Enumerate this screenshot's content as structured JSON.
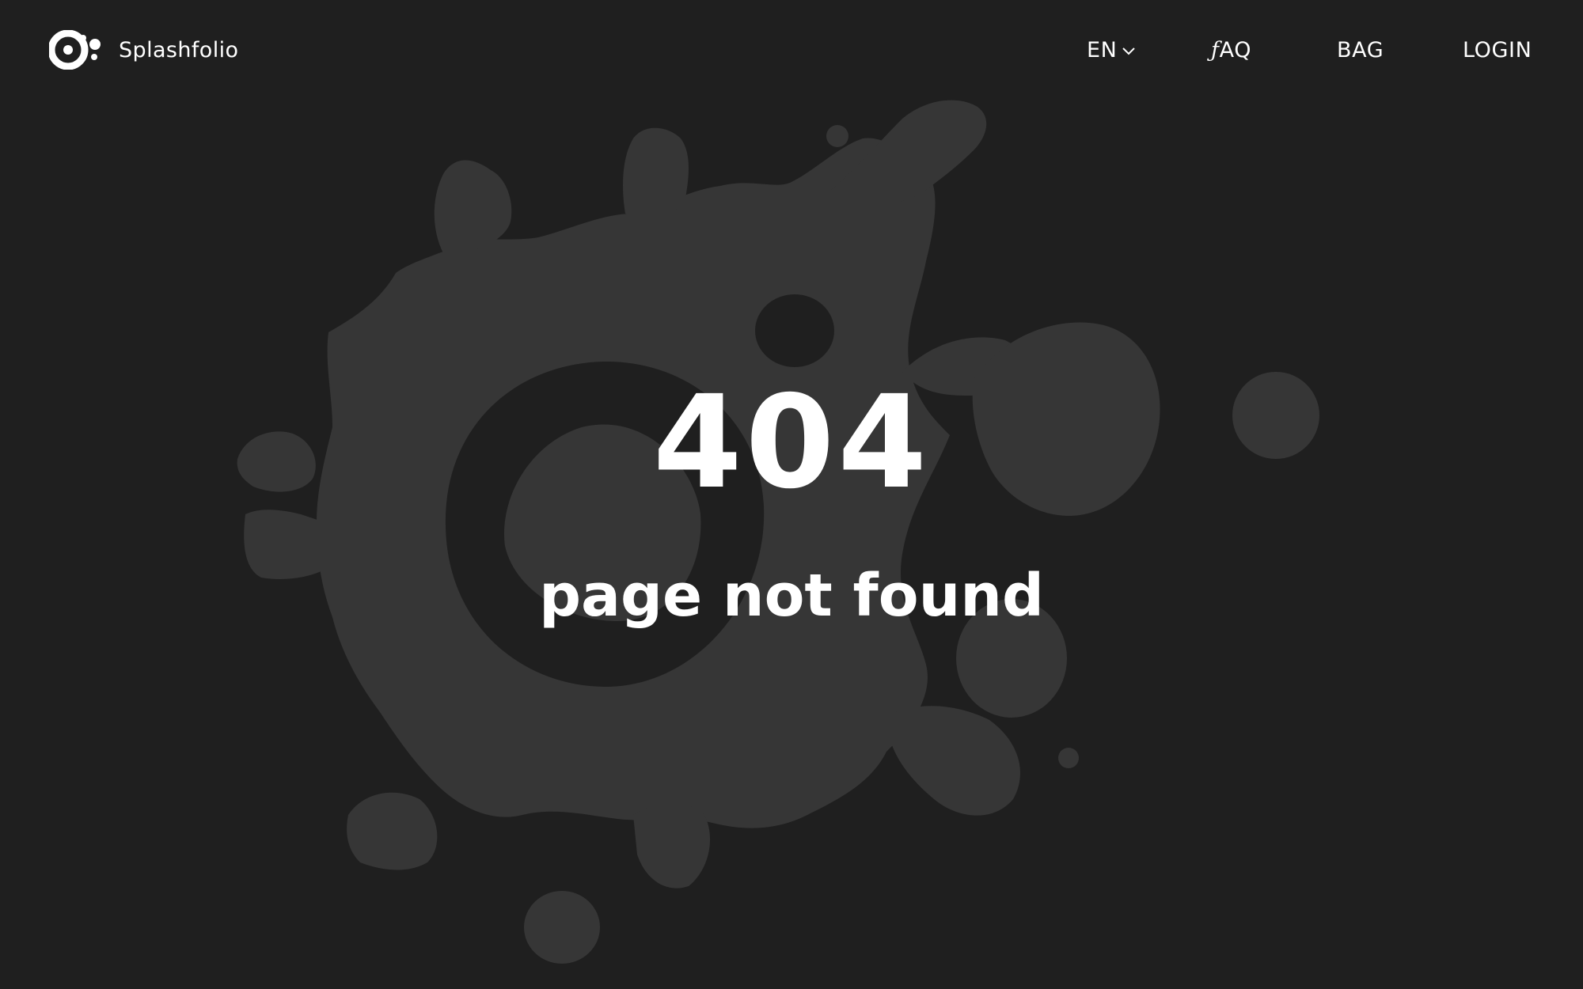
{
  "brand": {
    "name": "Splashfolio",
    "logo_icon": "splash-logo-icon"
  },
  "nav": {
    "language": "EN",
    "language_icon": "chevron-down-icon",
    "faq": "AQ",
    "faq_prefix": "ƒ",
    "bag": "BAG",
    "login": "LOGIN"
  },
  "error": {
    "code": "404",
    "message": "page not found"
  },
  "colors": {
    "background": "#1f1f1f",
    "splash": "#363636",
    "text": "#ffffff"
  }
}
